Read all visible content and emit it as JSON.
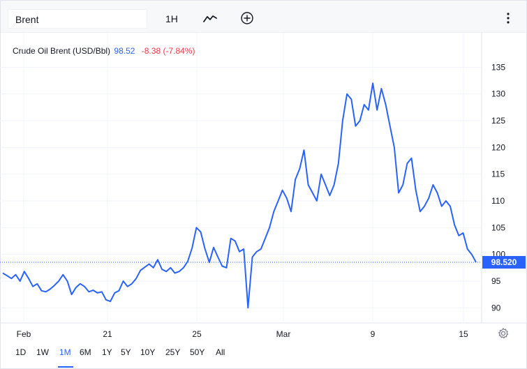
{
  "toolbar": {
    "symbol": "Brent",
    "interval": "1H",
    "line_icon": "line-chart-icon",
    "add_icon": "plus-circle-icon",
    "more_icon": "more-vertical-icon"
  },
  "legend": {
    "name": "Crude Oil Brent (USD/Bbl)",
    "price": "98.52",
    "change": "-8.38 (-7.84%)"
  },
  "last_price_label": "98.520",
  "colors": {
    "line": "#2962ff",
    "down": "#f23645",
    "grid": "#f0f3fa"
  },
  "ranges": [
    "1D",
    "1W",
    "1M",
    "6M",
    "1Y",
    "5Y",
    "10Y",
    "25Y",
    "50Y",
    "All"
  ],
  "active_range": "1M",
  "chart_data": {
    "type": "line",
    "series": [
      {
        "values": [
          96.5,
          96.0,
          95.5,
          96.2,
          95.0,
          96.8,
          95.5,
          94.0,
          94.5,
          93.2,
          93.0,
          93.5,
          94.2,
          95.0,
          96.2,
          95.0,
          92.5,
          93.8,
          94.5,
          94.0,
          93.0,
          93.3,
          92.8,
          93.0,
          91.5,
          91.2,
          92.8,
          93.2,
          95.0,
          94.0,
          94.5,
          95.5,
          97.0,
          97.6,
          98.2,
          97.5,
          99.0,
          97.2,
          96.8,
          97.5,
          96.5,
          96.8,
          97.5,
          98.7,
          101.2,
          105.0,
          104.2,
          101.0,
          98.5,
          101.3,
          99.5,
          97.8,
          97.5,
          103.0,
          102.5,
          100.5,
          101.0,
          90.0,
          99.5,
          100.5,
          101.0,
          103.0,
          105.0,
          108.0,
          110.0,
          112.0,
          110.5,
          108.0,
          114.0,
          116.0,
          119.5,
          113.0,
          111.5,
          110.0,
          115.0,
          113.0,
          111.0,
          113.0,
          117.0,
          125.0,
          130.0,
          129.0,
          124.0,
          125.0,
          128.0,
          127.0,
          132.0,
          127.0,
          131.0,
          128.0,
          124.0,
          120.0,
          111.5,
          113.0,
          117.0,
          118.0,
          112.0,
          108.0,
          109.0,
          110.5,
          113.0,
          111.5,
          109.0,
          110.0,
          109.0,
          105.5,
          103.5,
          104.0,
          101.0,
          100.0,
          98.52
        ]
      }
    ],
    "x_tick_labels": [
      "Feb",
      "21",
      "25",
      "Mar",
      "9",
      "15"
    ],
    "y_tick_labels": [
      "90",
      "95",
      "100",
      "105",
      "110",
      "115",
      "120",
      "125",
      "130",
      "135"
    ],
    "ylim": [
      88,
      137
    ],
    "grid": true,
    "last_value": 98.52
  }
}
